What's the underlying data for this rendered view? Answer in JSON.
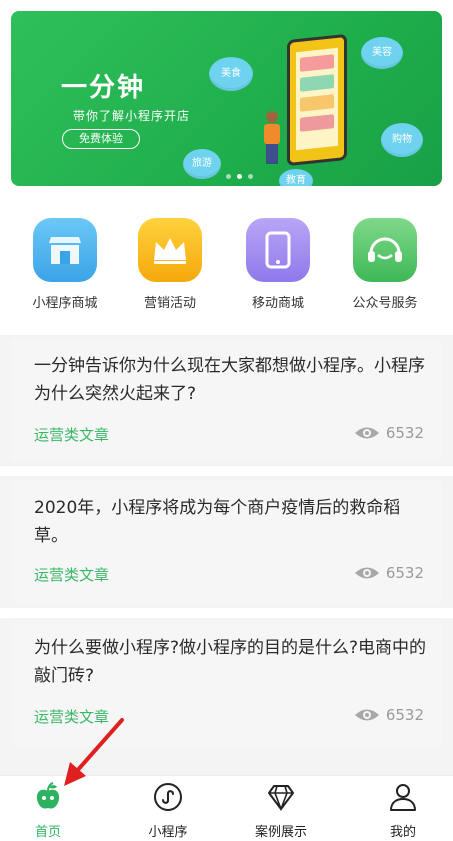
{
  "banner": {
    "title": "一分钟",
    "subtitle": "带你了解小程序开店",
    "button_label": "免费体验",
    "clouds": [
      "美食",
      "美容",
      "购物",
      "旅游",
      "教育"
    ],
    "slide_index": 1,
    "slide_count": 3,
    "colors": {
      "bg": "#22b352",
      "cloud": "#6fd3f0"
    }
  },
  "categories": [
    {
      "label": "小程序商城",
      "icon": "shop-icon",
      "color": "#4fb7ee"
    },
    {
      "label": "营销活动",
      "icon": "crown-icon",
      "color": "#f7b814"
    },
    {
      "label": "移动商城",
      "icon": "mobile-phone-icon",
      "color": "#a18cf0"
    },
    {
      "label": "公众号服务",
      "icon": "headset-icon",
      "color": "#5cc96d"
    }
  ],
  "articles": [
    {
      "title": "一分钟告诉你为什么现在大家都想做小程序。小程序为什么突然火起来了?",
      "tag": "运营类文章",
      "views": "6532"
    },
    {
      "title": "2020年，小程序将成为每个商户疫情后的救命稻草。",
      "tag": "运营类文章",
      "views": "6532"
    },
    {
      "title": "为什么要做小程序?做小程序的目的是什么?电商中的敲门砖?",
      "tag": "运营类文章",
      "views": "6532"
    }
  ],
  "tabbar": {
    "items": [
      {
        "label": "首页",
        "icon": "home-apple-icon",
        "active": true
      },
      {
        "label": "小程序",
        "icon": "mini-program-icon",
        "active": false
      },
      {
        "label": "案例展示",
        "icon": "diamond-icon",
        "active": false
      },
      {
        "label": "我的",
        "icon": "user-icon",
        "active": false
      }
    ],
    "active_color": "#2db360"
  },
  "annotation": {
    "arrow_color": "#e02020"
  }
}
